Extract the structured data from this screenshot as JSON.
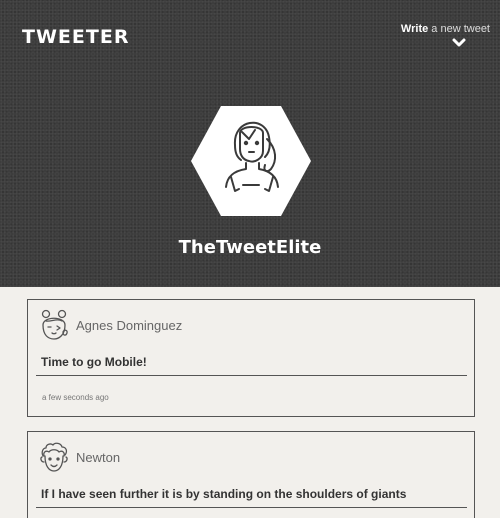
{
  "header": {
    "logo": "TWEETER",
    "compose_bold": "Write",
    "compose_rest": " a new tweet",
    "handle": "TheTweetElite"
  },
  "tweets": [
    {
      "name": "Agnes Dominguez",
      "text": "Time to go Mobile!",
      "time": "a few seconds ago",
      "avatar_icon": "girl-face-icon"
    },
    {
      "name": "Newton",
      "text": "If I have seen further it is by standing on the shoulders of giants",
      "avatar_icon": "curly-hair-man-icon"
    }
  ],
  "colors": {
    "header_bg": "#3d3d3d",
    "page_bg": "#f2f0ec",
    "border": "#555555"
  }
}
